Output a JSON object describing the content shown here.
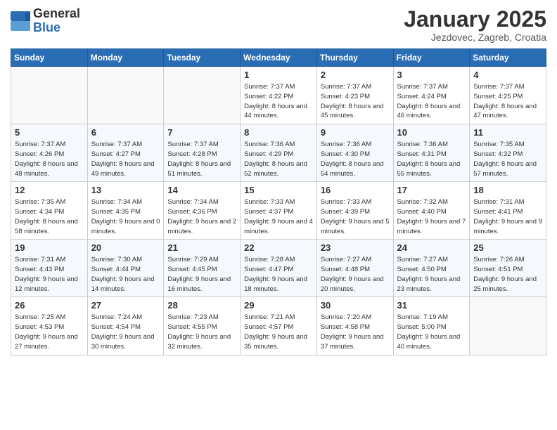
{
  "logo": {
    "general": "General",
    "blue": "Blue"
  },
  "header": {
    "title": "January 2025",
    "subtitle": "Jezdovec, Zagreb, Croatia"
  },
  "weekdays": [
    "Sunday",
    "Monday",
    "Tuesday",
    "Wednesday",
    "Thursday",
    "Friday",
    "Saturday"
  ],
  "weeks": [
    [
      {
        "day": "",
        "sunrise": "",
        "sunset": "",
        "daylight": ""
      },
      {
        "day": "",
        "sunrise": "",
        "sunset": "",
        "daylight": ""
      },
      {
        "day": "",
        "sunrise": "",
        "sunset": "",
        "daylight": ""
      },
      {
        "day": "1",
        "sunrise": "Sunrise: 7:37 AM",
        "sunset": "Sunset: 4:22 PM",
        "daylight": "Daylight: 8 hours and 44 minutes."
      },
      {
        "day": "2",
        "sunrise": "Sunrise: 7:37 AM",
        "sunset": "Sunset: 4:23 PM",
        "daylight": "Daylight: 8 hours and 45 minutes."
      },
      {
        "day": "3",
        "sunrise": "Sunrise: 7:37 AM",
        "sunset": "Sunset: 4:24 PM",
        "daylight": "Daylight: 8 hours and 46 minutes."
      },
      {
        "day": "4",
        "sunrise": "Sunrise: 7:37 AM",
        "sunset": "Sunset: 4:25 PM",
        "daylight": "Daylight: 8 hours and 47 minutes."
      }
    ],
    [
      {
        "day": "5",
        "sunrise": "Sunrise: 7:37 AM",
        "sunset": "Sunset: 4:26 PM",
        "daylight": "Daylight: 8 hours and 48 minutes."
      },
      {
        "day": "6",
        "sunrise": "Sunrise: 7:37 AM",
        "sunset": "Sunset: 4:27 PM",
        "daylight": "Daylight: 8 hours and 49 minutes."
      },
      {
        "day": "7",
        "sunrise": "Sunrise: 7:37 AM",
        "sunset": "Sunset: 4:28 PM",
        "daylight": "Daylight: 8 hours and 51 minutes."
      },
      {
        "day": "8",
        "sunrise": "Sunrise: 7:36 AM",
        "sunset": "Sunset: 4:29 PM",
        "daylight": "Daylight: 8 hours and 52 minutes."
      },
      {
        "day": "9",
        "sunrise": "Sunrise: 7:36 AM",
        "sunset": "Sunset: 4:30 PM",
        "daylight": "Daylight: 8 hours and 54 minutes."
      },
      {
        "day": "10",
        "sunrise": "Sunrise: 7:36 AM",
        "sunset": "Sunset: 4:31 PM",
        "daylight": "Daylight: 8 hours and 55 minutes."
      },
      {
        "day": "11",
        "sunrise": "Sunrise: 7:35 AM",
        "sunset": "Sunset: 4:32 PM",
        "daylight": "Daylight: 8 hours and 57 minutes."
      }
    ],
    [
      {
        "day": "12",
        "sunrise": "Sunrise: 7:35 AM",
        "sunset": "Sunset: 4:34 PM",
        "daylight": "Daylight: 8 hours and 58 minutes."
      },
      {
        "day": "13",
        "sunrise": "Sunrise: 7:34 AM",
        "sunset": "Sunset: 4:35 PM",
        "daylight": "Daylight: 9 hours and 0 minutes."
      },
      {
        "day": "14",
        "sunrise": "Sunrise: 7:34 AM",
        "sunset": "Sunset: 4:36 PM",
        "daylight": "Daylight: 9 hours and 2 minutes."
      },
      {
        "day": "15",
        "sunrise": "Sunrise: 7:33 AM",
        "sunset": "Sunset: 4:37 PM",
        "daylight": "Daylight: 9 hours and 4 minutes."
      },
      {
        "day": "16",
        "sunrise": "Sunrise: 7:33 AM",
        "sunset": "Sunset: 4:39 PM",
        "daylight": "Daylight: 9 hours and 5 minutes."
      },
      {
        "day": "17",
        "sunrise": "Sunrise: 7:32 AM",
        "sunset": "Sunset: 4:40 PM",
        "daylight": "Daylight: 9 hours and 7 minutes."
      },
      {
        "day": "18",
        "sunrise": "Sunrise: 7:31 AM",
        "sunset": "Sunset: 4:41 PM",
        "daylight": "Daylight: 9 hours and 9 minutes."
      }
    ],
    [
      {
        "day": "19",
        "sunrise": "Sunrise: 7:31 AM",
        "sunset": "Sunset: 4:43 PM",
        "daylight": "Daylight: 9 hours and 12 minutes."
      },
      {
        "day": "20",
        "sunrise": "Sunrise: 7:30 AM",
        "sunset": "Sunset: 4:44 PM",
        "daylight": "Daylight: 9 hours and 14 minutes."
      },
      {
        "day": "21",
        "sunrise": "Sunrise: 7:29 AM",
        "sunset": "Sunset: 4:45 PM",
        "daylight": "Daylight: 9 hours and 16 minutes."
      },
      {
        "day": "22",
        "sunrise": "Sunrise: 7:28 AM",
        "sunset": "Sunset: 4:47 PM",
        "daylight": "Daylight: 9 hours and 18 minutes."
      },
      {
        "day": "23",
        "sunrise": "Sunrise: 7:27 AM",
        "sunset": "Sunset: 4:48 PM",
        "daylight": "Daylight: 9 hours and 20 minutes."
      },
      {
        "day": "24",
        "sunrise": "Sunrise: 7:27 AM",
        "sunset": "Sunset: 4:50 PM",
        "daylight": "Daylight: 9 hours and 23 minutes."
      },
      {
        "day": "25",
        "sunrise": "Sunrise: 7:26 AM",
        "sunset": "Sunset: 4:51 PM",
        "daylight": "Daylight: 9 hours and 25 minutes."
      }
    ],
    [
      {
        "day": "26",
        "sunrise": "Sunrise: 7:25 AM",
        "sunset": "Sunset: 4:53 PM",
        "daylight": "Daylight: 9 hours and 27 minutes."
      },
      {
        "day": "27",
        "sunrise": "Sunrise: 7:24 AM",
        "sunset": "Sunset: 4:54 PM",
        "daylight": "Daylight: 9 hours and 30 minutes."
      },
      {
        "day": "28",
        "sunrise": "Sunrise: 7:23 AM",
        "sunset": "Sunset: 4:55 PM",
        "daylight": "Daylight: 9 hours and 32 minutes."
      },
      {
        "day": "29",
        "sunrise": "Sunrise: 7:21 AM",
        "sunset": "Sunset: 4:57 PM",
        "daylight": "Daylight: 9 hours and 35 minutes."
      },
      {
        "day": "30",
        "sunrise": "Sunrise: 7:20 AM",
        "sunset": "Sunset: 4:58 PM",
        "daylight": "Daylight: 9 hours and 37 minutes."
      },
      {
        "day": "31",
        "sunrise": "Sunrise: 7:19 AM",
        "sunset": "Sunset: 5:00 PM",
        "daylight": "Daylight: 9 hours and 40 minutes."
      },
      {
        "day": "",
        "sunrise": "",
        "sunset": "",
        "daylight": ""
      }
    ]
  ]
}
